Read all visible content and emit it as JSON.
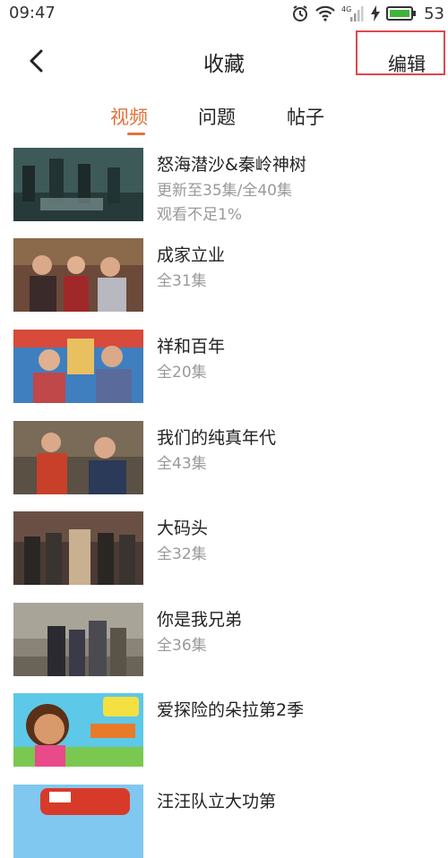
{
  "status_bar": {
    "time": "09:47",
    "battery": "53",
    "network": "4G"
  },
  "nav": {
    "title": "收藏",
    "edit_label": "编辑"
  },
  "tabs": [
    {
      "label": "视频",
      "active": true
    },
    {
      "label": "问题",
      "active": false
    },
    {
      "label": "帖子",
      "active": false
    }
  ],
  "colors": {
    "accent": "#e4713a",
    "highlight_box": "#e0474c",
    "secondary_text": "#999999"
  },
  "videos": [
    {
      "title": "怒海潜沙&秦岭神树",
      "subtitle": "更新至35集/全40集",
      "progress": "观看不足1%"
    },
    {
      "title": "成家立业",
      "subtitle": "全31集"
    },
    {
      "title": "祥和百年",
      "subtitle": "全20集"
    },
    {
      "title": "我们的纯真年代",
      "subtitle": "全43集"
    },
    {
      "title": "大码头",
      "subtitle": "全32集"
    },
    {
      "title": "你是我兄弟",
      "subtitle": "全36集"
    },
    {
      "title": "爱探险的朵拉第2季",
      "subtitle": ""
    },
    {
      "title": "汪汪队立大功第",
      "subtitle": ""
    }
  ]
}
